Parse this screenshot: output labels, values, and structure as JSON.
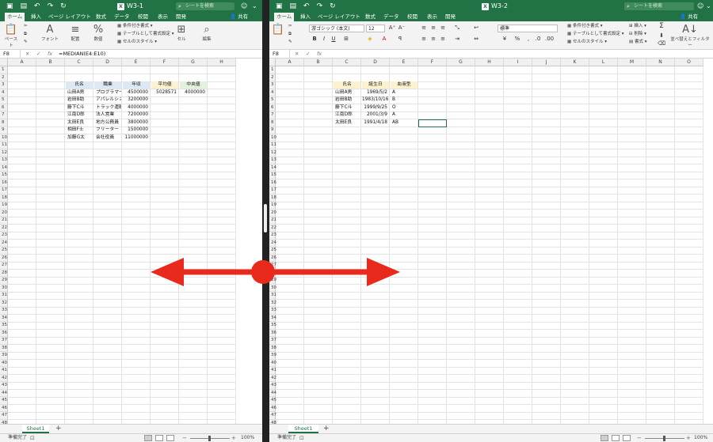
{
  "left": {
    "title": "W3-1",
    "search_placeholder": "シートを検索",
    "share_label": "共有",
    "tabs": [
      "ホーム",
      "挿入",
      "ページ レイアウト",
      "数式",
      "データ",
      "校閲",
      "表示",
      "開発"
    ],
    "ribbon": {
      "paste": "ペースト",
      "font": "フォント",
      "align": "配置",
      "number": "数値",
      "cond_format": "条件付き書式",
      "table_format": "テーブルとして書式設定",
      "cell_style": "セルのスタイル",
      "cells": "セル",
      "edit": "編集"
    },
    "namebox": "F8",
    "formula": "=MEDIAN(E4:E10)",
    "columns": [
      "A",
      "B",
      "C",
      "D",
      "E",
      "F",
      "G",
      "H"
    ],
    "table_headers": [
      "氏名",
      "職業",
      "年収"
    ],
    "stat_headers": [
      "平均値",
      "中央値"
    ],
    "stat_values": [
      "5028571",
      "4000000"
    ],
    "rows": [
      [
        "山田A男",
        "プログラマー",
        "4500000"
      ],
      [
        "岩田B助",
        "アパレルショップ店員",
        "3200000"
      ],
      [
        "藤下C斗",
        "トラック運転手",
        "4000000"
      ],
      [
        "江南D郎",
        "法人営業",
        "7200000"
      ],
      [
        "太田E良",
        "地方公務員",
        "3800000"
      ],
      [
        "相田F士",
        "フリーター",
        "1500000"
      ],
      [
        "加藤G太",
        "会社役員",
        "11000000"
      ]
    ],
    "sheet_tab": "Sheet1",
    "status": "準備完了",
    "zoom": "100%"
  },
  "right": {
    "title": "W3-2",
    "search_placeholder": "シートを検索",
    "share_label": "共有",
    "tabs": [
      "ホーム",
      "挿入",
      "ページ レイアウト",
      "数式",
      "データ",
      "校閲",
      "表示",
      "開発"
    ],
    "ribbon": {
      "font_name": "游ゴシック (本文)",
      "font_size": "12",
      "number_format": "標準",
      "cond_format": "条件付き書式",
      "table_format": "テーブルとして書式設定",
      "cell_style": "セルのスタイル",
      "insert": "挿入",
      "delete": "削除",
      "format": "書式",
      "sort_filter": "並べ替えとフィルター"
    },
    "namebox": "F8",
    "formula": "",
    "columns": [
      "A",
      "B",
      "C",
      "D",
      "E",
      "F",
      "G",
      "H",
      "I",
      "J",
      "K",
      "L",
      "M",
      "N",
      "O"
    ],
    "table_headers": [
      "氏名",
      "誕生日",
      "血液型"
    ],
    "rows": [
      [
        "山田A男",
        "1969/5/2",
        "A"
      ],
      [
        "岩田B助",
        "1983/10/16",
        "B"
      ],
      [
        "藤下C斗",
        "1999/9/25",
        "O"
      ],
      [
        "江南D郎",
        "2001/3/9",
        "A"
      ],
      [
        "太田E良",
        "1991/4/18",
        "AB"
      ]
    ],
    "sheet_tab": "Sheet1",
    "status": "準備完了",
    "zoom": "100%"
  },
  "colors": {
    "excel_green": "#217346",
    "arrow_red": "#e8291c"
  },
  "icons": [
    "search-icon",
    "save-icon",
    "undo-icon",
    "redo-icon",
    "share-icon",
    "paste-icon",
    "fx-icon",
    "double-arrow"
  ]
}
